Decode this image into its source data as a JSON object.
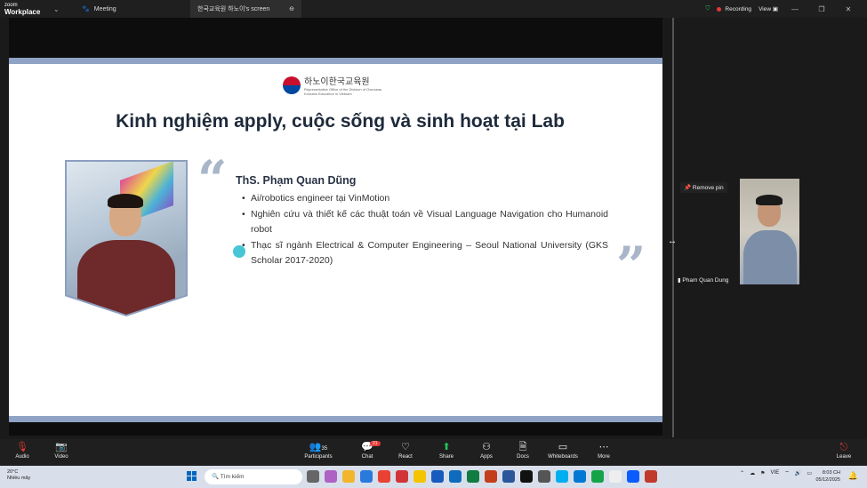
{
  "titlebar": {
    "brand_line1": "zoom",
    "brand_line2": "Workplace",
    "meeting_tab": "Meeting",
    "share_tab": "한국교육원 하노이's screen",
    "recording_label": "Recording",
    "view_label": "View"
  },
  "slide": {
    "logo_korean": "하노이한국교육원",
    "logo_sub": "Representative Office of the Division of Overseas Koreans Education in Vietnam",
    "title": "Kinh nghiệm apply, cuộc sống và sinh hoạt tại Lab",
    "speaker": "ThS. Phạm Quan Dũng",
    "bullets": [
      "Ai/robotics engineer tại VinMotion",
      "Nghiên cứu và thiết kế các thuật toán về Visual Language Navigation cho Humanoid robot",
      "Thạc sĩ ngành Electrical & Computer Engineering – Seoul National University (GKS Scholar 2017-2020)"
    ]
  },
  "sidebar": {
    "remove_pin": "Remove pin",
    "participant_name": "Pham Quan Dung"
  },
  "toolbar": {
    "audio": "Audio",
    "video": "Video",
    "participants": "Participants",
    "participants_count": "35",
    "chat": "Chat",
    "chat_badge": "21",
    "react": "React",
    "share": "Share",
    "apps": "Apps",
    "docs": "Docs",
    "whiteboards": "Whiteboards",
    "more": "More",
    "leave": "Leave"
  },
  "taskbar": {
    "weather_temp": "20°C",
    "weather_desc": "Nhiều mây",
    "search_placeholder": "Tìm kiếm",
    "lang": "VIE",
    "time": "8:03 CH",
    "date": "05/12/2025"
  },
  "colors": {
    "slide_accent": "#8fa3c4",
    "recording_red": "#e53935",
    "share_green": "#22c55e"
  }
}
